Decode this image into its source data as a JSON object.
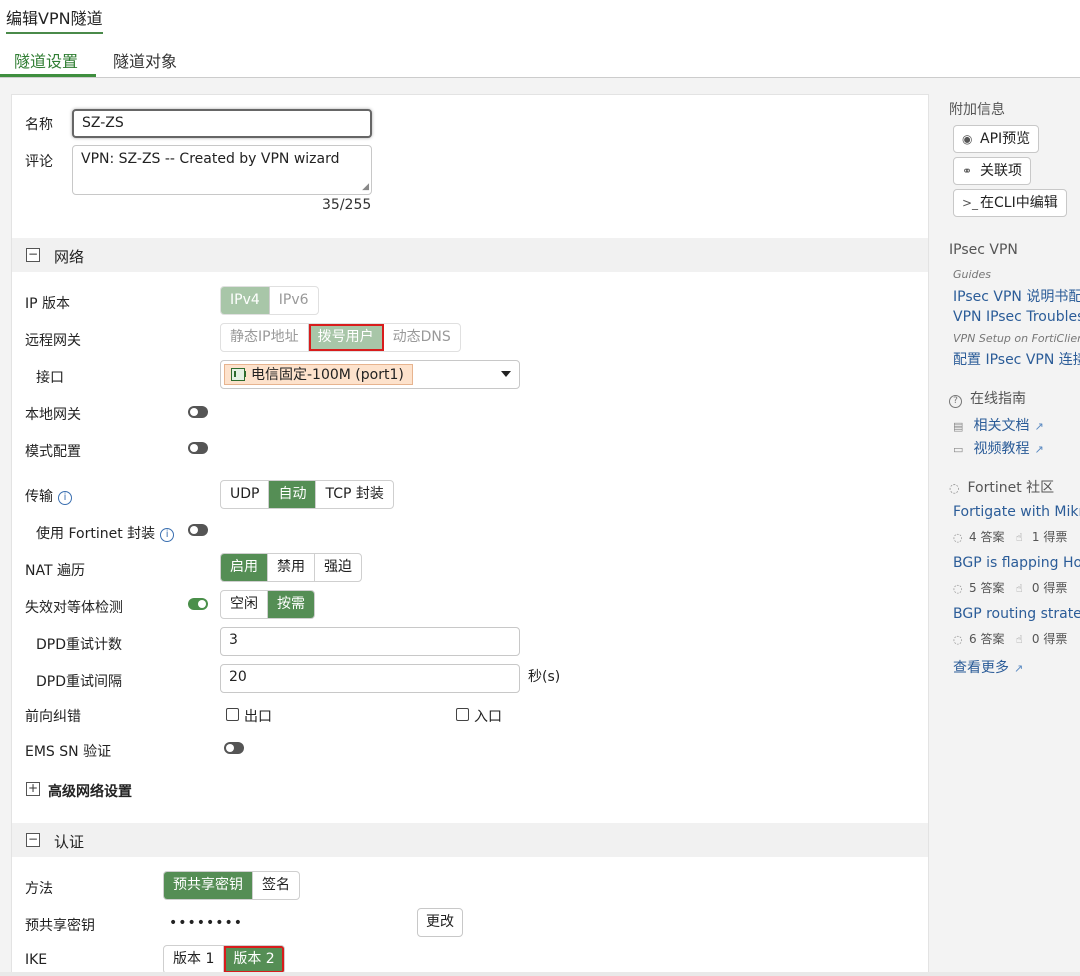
{
  "page": {
    "title": "编辑VPN隧道"
  },
  "tabs": [
    {
      "label": "隧道设置"
    },
    {
      "label": "隧道对象"
    }
  ],
  "form": {
    "name": {
      "label": "名称",
      "value": "SZ-ZS"
    },
    "comment": {
      "label": "评论",
      "value": "VPN: SZ-ZS -- Created by VPN wizard",
      "counter": "35/255"
    },
    "network": {
      "section": "网络",
      "toggle_symbol": "−",
      "ip_version": {
        "label": "IP 版本",
        "options": [
          "IPv4",
          "IPv6"
        ],
        "selected": "IPv4"
      },
      "remote_gateway": {
        "label": "远程网关",
        "options": [
          "静态IP地址",
          "拨号用户",
          "动态DNS"
        ],
        "selected": "拨号用户"
      },
      "interface": {
        "label": "接口",
        "value": "电信固定-100M (port1)"
      },
      "local_gateway": {
        "label": "本地网关",
        "enabled": false
      },
      "mode_config": {
        "label": "模式配置",
        "enabled": false
      },
      "transport": {
        "label": "传输",
        "options": [
          "UDP",
          "自动",
          "TCP 封装"
        ],
        "selected": "自动"
      },
      "fortinet_encap": {
        "label": "使用 Fortinet 封装",
        "enabled": false
      },
      "nat_traversal": {
        "label": "NAT 遍历",
        "options": [
          "启用",
          "禁用",
          "强迫"
        ],
        "selected": "启用"
      },
      "dpd": {
        "label": "失效对等体检测",
        "enabled": true,
        "options": [
          "空闲",
          "按需"
        ],
        "selected": "按需"
      },
      "dpd_retry_count": {
        "label": "DPD重试计数",
        "value": "3"
      },
      "dpd_retry_interval": {
        "label": "DPD重试间隔",
        "value": "20",
        "unit": "秒(s)"
      },
      "fec": {
        "label": "前向纠错",
        "egress": "出口",
        "ingress": "入口"
      },
      "ems_sn": {
        "label": "EMS SN 验证",
        "enabled": false
      },
      "advanced": {
        "label": "高级网络设置",
        "toggle_symbol": "+"
      }
    },
    "auth": {
      "section": "认证",
      "toggle_symbol": "−",
      "method": {
        "label": "方法",
        "options": [
          "预共享密钥",
          "签名"
        ],
        "selected": "预共享密钥"
      },
      "psk": {
        "label": "预共享密钥",
        "value": "••••••••",
        "change_button": "更改"
      },
      "ike": {
        "label": "IKE",
        "options": [
          "版本 1",
          "版本 2"
        ],
        "selected": "版本 2"
      }
    }
  },
  "sidebar": {
    "additional_info": "附加信息",
    "buttons": [
      {
        "label": "API预览"
      },
      {
        "label": "关联项"
      },
      {
        "label": "在CLI中编辑"
      }
    ],
    "ipsec_title": "IPsec VPN",
    "guides_label": "Guides",
    "guide_links": [
      "IPsec VPN 说明书配置",
      "VPN IPsec Troubleshooting"
    ],
    "forticlient_label": "VPN Setup on FortiClient",
    "forticlient_link": "配置 IPsec VPN 连接",
    "online_guide": "在线指南",
    "docs_link": "相关文档",
    "video_link": "视频教程",
    "community": "Fortinet 社区",
    "posts": [
      {
        "title": "Fortigate with Mikrotik",
        "answers": "4 答案",
        "likes": "1 得票"
      },
      {
        "title": "BGP is flapping Hold",
        "answers": "5 答案",
        "likes": "0 得票"
      },
      {
        "title": "BGP routing strategy",
        "answers": "6 答案",
        "likes": "0 得票"
      }
    ],
    "see_more": "查看更多"
  },
  "colors": {
    "accent": "#558e55",
    "highlight": "#d81c1c",
    "link": "#2b5c98"
  }
}
